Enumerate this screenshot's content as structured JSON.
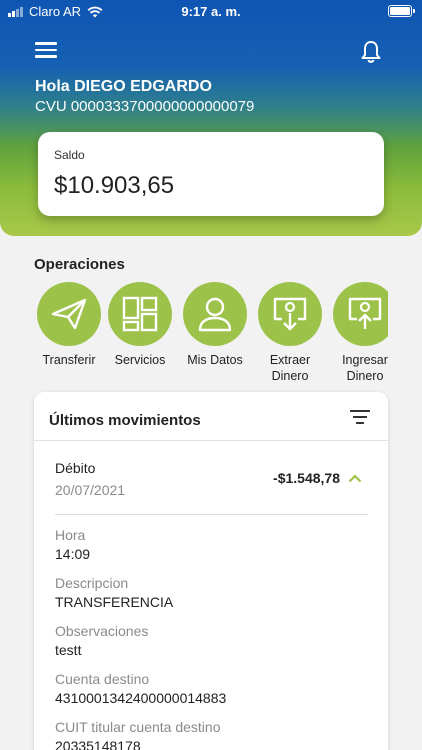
{
  "status_bar": {
    "carrier": "Claro AR",
    "time": "9:17 a. m."
  },
  "header": {
    "greeting": "Hola DIEGO EDGARDO",
    "cvu": "CVU 0000333700000000000079"
  },
  "balance": {
    "label": "Saldo",
    "value": "$10.903,65"
  },
  "operations": {
    "title": "Operaciones",
    "items": [
      {
        "label": "Transferir",
        "icon": "paper-plane-icon"
      },
      {
        "label": "Servicios",
        "icon": "grid-icon"
      },
      {
        "label": "Mis Datos",
        "icon": "user-icon"
      },
      {
        "label": "Extraer\nDinero",
        "icon": "withdraw-icon"
      },
      {
        "label": "Ingresar\nDinero",
        "icon": "deposit-icon"
      }
    ]
  },
  "movements": {
    "title": "Últimos movimientos",
    "transaction": {
      "type": "Débito",
      "date": "20/07/2021",
      "amount": "-$1.548,78",
      "details": [
        {
          "label": "Hora",
          "value": "14:09"
        },
        {
          "label": "Descripcion",
          "value": "TRANSFERENCIA"
        },
        {
          "label": "Observaciones",
          "value": "testt"
        },
        {
          "label": "Cuenta destino",
          "value": "4310001342400000014883"
        },
        {
          "label": "CUIT titular cuenta destino",
          "value": "20335148178"
        }
      ]
    }
  },
  "colors": {
    "accent_green": "#9cc24a",
    "header_blue": "#0f55b3"
  }
}
